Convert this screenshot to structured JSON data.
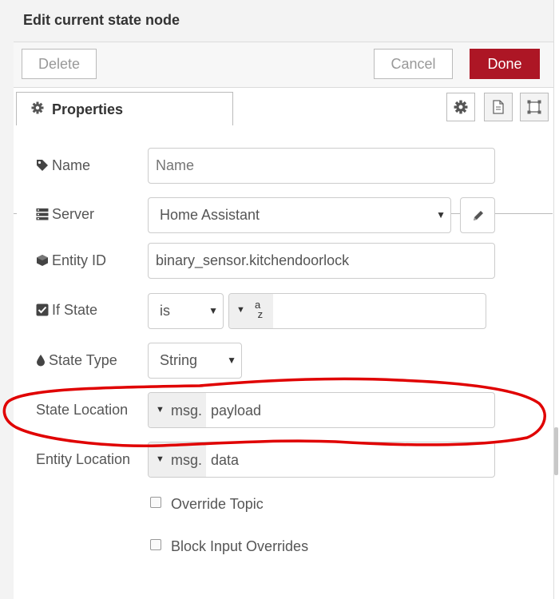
{
  "tray": {
    "title": "Edit current state node",
    "buttons": {
      "delete": "Delete",
      "cancel": "Cancel",
      "done": "Done"
    },
    "accent_color": "#ad1625"
  },
  "tabs": {
    "properties": "Properties",
    "icons": [
      "gear-icon",
      "document-icon",
      "frame-icon"
    ]
  },
  "fields": {
    "name": {
      "label": "Name",
      "placeholder": "Name",
      "value": ""
    },
    "server": {
      "label": "Server",
      "value": "Home Assistant"
    },
    "entity_id": {
      "label": "Entity ID",
      "value": "binary_sensor.kitchendoorlock"
    },
    "if_state": {
      "label": "If State",
      "operator": "is",
      "type_label": "a z",
      "value": ""
    },
    "state_type": {
      "label": "State Type",
      "value": "String"
    },
    "state_location": {
      "label": "State Location",
      "type": "msg.",
      "value": "payload"
    },
    "entity_location": {
      "label": "Entity Location",
      "type": "msg.",
      "value": "data"
    }
  },
  "checkboxes": {
    "override_topic": {
      "label": "Override Topic",
      "checked": false
    },
    "block_input_overrides": {
      "label": "Block Input Overrides",
      "checked": false
    }
  },
  "annotation": {
    "color": "#e00000",
    "shape": "freehand ellipse around State Location"
  }
}
